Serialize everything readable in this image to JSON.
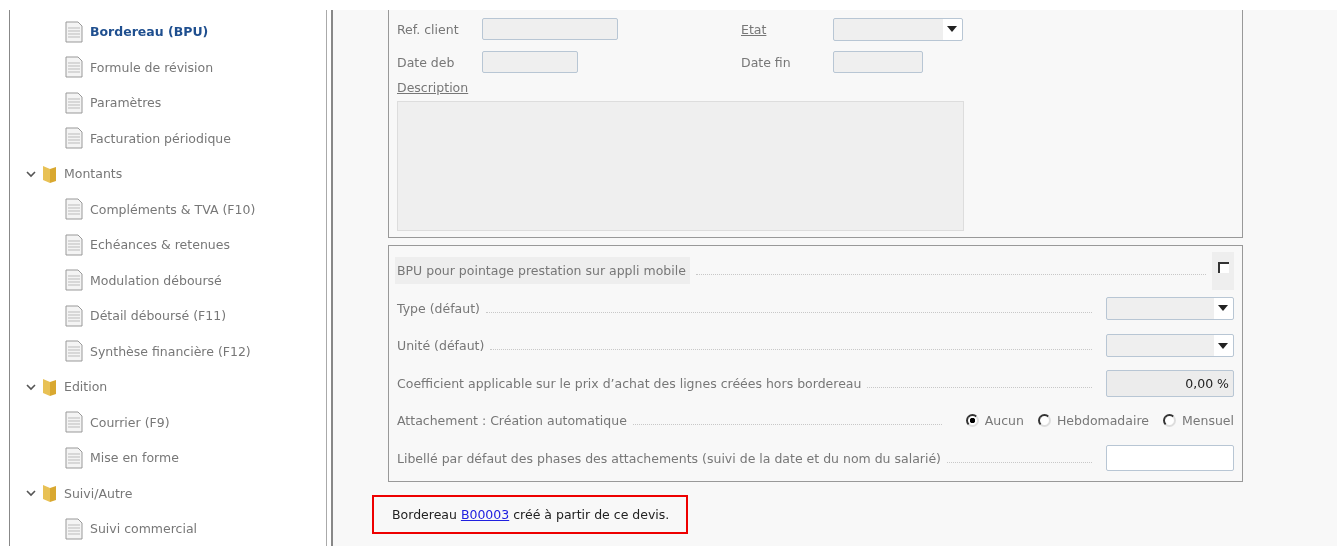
{
  "tree": [
    {
      "kind": "leaf",
      "label": "Bordereau (BPU)",
      "selected": true
    },
    {
      "kind": "leaf",
      "label": "Formule de révision",
      "selected": false
    },
    {
      "kind": "leaf",
      "label": "Paramètres",
      "selected": false
    },
    {
      "kind": "leaf",
      "label": "Facturation périodique",
      "selected": false
    },
    {
      "kind": "folder",
      "label": "Montants",
      "expanded": true,
      "children": [
        {
          "kind": "leaf",
          "label": "Compléments & TVA (F10)",
          "selected": false
        },
        {
          "kind": "leaf",
          "label": "Echéances & retenues",
          "selected": false
        },
        {
          "kind": "leaf",
          "label": "Modulation déboursé",
          "selected": false
        },
        {
          "kind": "leaf",
          "label": "Détail déboursé (F11)",
          "selected": false
        },
        {
          "kind": "leaf",
          "label": "Synthèse financière (F12)",
          "selected": false
        }
      ]
    },
    {
      "kind": "folder",
      "label": "Edition",
      "expanded": true,
      "children": [
        {
          "kind": "leaf",
          "label": "Courrier (F9)",
          "selected": false
        },
        {
          "kind": "leaf",
          "label": "Mise en forme",
          "selected": false
        }
      ]
    },
    {
      "kind": "folder",
      "label": "Suivi/Autre",
      "expanded": true,
      "children": [
        {
          "kind": "leaf",
          "label": "Suivi commercial",
          "selected": false
        }
      ]
    }
  ],
  "header_form": {
    "ref_client": {
      "label": "Ref. client",
      "underlined": false
    },
    "etat": {
      "label": "Etat",
      "underlined": true
    },
    "date_deb": {
      "label": "Date deb",
      "underlined": false
    },
    "date_fin": {
      "label": "Date fin",
      "underlined": false
    },
    "description": {
      "label": "Description",
      "underlined": true
    }
  },
  "settings": [
    {
      "kind": "checkbox",
      "label": "BPU pour pointage prestation sur appli mobile",
      "checked": false
    },
    {
      "kind": "select",
      "label": "Type (défaut)"
    },
    {
      "kind": "select",
      "label": "Unité (défaut)"
    },
    {
      "kind": "number",
      "label": "Coefficient applicable sur le prix d’achat des lignes créées hors bordereau",
      "value": "0,00 %"
    },
    {
      "kind": "radio",
      "label": "Attachement : Création automatique",
      "options": [
        {
          "label": "Aucun",
          "selected": true
        },
        {
          "label": "Hebdomadaire",
          "selected": false
        },
        {
          "label": "Mensuel",
          "selected": false
        }
      ]
    },
    {
      "kind": "text",
      "label": "Libellé par défaut des phases des attachements (suivi de la date et du nom du salarié)"
    }
  ],
  "message": {
    "before": "Bordereau",
    "link": "B00003",
    "after": "créé à partir de ce devis."
  }
}
